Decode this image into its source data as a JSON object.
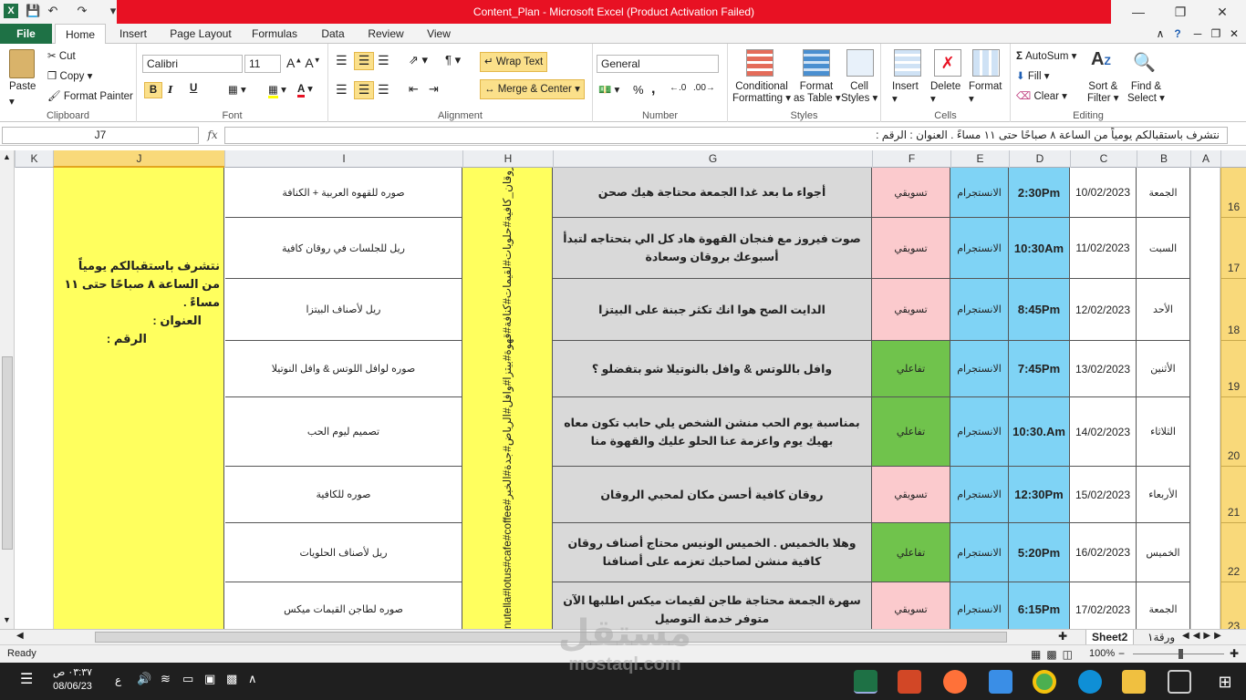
{
  "window": {
    "title": "Content_Plan  -  Microsoft Excel (Product Activation Failed)"
  },
  "tabs": [
    "File",
    "Home",
    "Insert",
    "Page Layout",
    "Formulas",
    "Data",
    "Review",
    "View"
  ],
  "ribbon": {
    "clipboard": {
      "paste": "Paste",
      "cut": "Cut",
      "copy": "Copy",
      "format_painter": "Format Painter",
      "label": "Clipboard"
    },
    "font": {
      "name": "Calibri",
      "size": "11",
      "bold": "B",
      "italic": "I",
      "underline": "U",
      "label": "Font"
    },
    "alignment": {
      "wrap_text": "Wrap Text",
      "merge_center": "Merge & Center",
      "label": "Alignment"
    },
    "number": {
      "format": "General",
      "percent": "%",
      "comma": ",",
      "label": "Number"
    },
    "styles": {
      "conditional_1": "Conditional",
      "conditional_2": "Formatting",
      "format_as_table_1": "Format",
      "format_as_table_2": "as Table",
      "cell_styles_1": "Cell",
      "cell_styles_2": "Styles",
      "label": "Styles"
    },
    "cells": {
      "insert": "Insert",
      "delete": "Delete",
      "format": "Format",
      "label": "Cells"
    },
    "editing": {
      "autosum": "AutoSum",
      "fill": "Fill",
      "clear": "Clear",
      "sort_1": "Sort &",
      "sort_2": "Filter",
      "find_1": "Find &",
      "find_2": "Select",
      "label": "Editing"
    }
  },
  "formula_bar": {
    "name_box": "J7",
    "fx": "fx",
    "content": "نتشرف باستقبالكم يومياً من الساعة ٨ صباحًا حتى ١١ مساءً .        العنوان :                         الرقم :"
  },
  "columns": [
    "K",
    "J",
    "I",
    "H",
    "G",
    "F",
    "E",
    "D",
    "C",
    "B",
    "A"
  ],
  "rows": [
    {
      "num": "16",
      "day": "الجمعة",
      "date": "10/02/2023",
      "time": "2:30Pm",
      "platform": "الانستجرام",
      "type": "تسويقي",
      "type_color": "pink",
      "text": "أجواء ما بعد غدا الجمعة محتاجة هيك صحن",
      "idea": "صوره للقهوه العربية + الكنافة"
    },
    {
      "num": "17",
      "day": "السبت",
      "date": "11/02/2023",
      "time": "10:30Am",
      "platform": "الانستجرام",
      "type": "تسويقي",
      "type_color": "pink",
      "text": "صوت فيروز مع فنجان القهوة هاد كل الي بتحتاجه لتبدأ أسبوعك بروقان وسعادة",
      "idea": "ريل للجلسات في روقان كافية"
    },
    {
      "num": "18",
      "day": "الأحد",
      "date": "12/02/2023",
      "time": "8:45Pm",
      "platform": "الانستجرام",
      "type": "تسويقي",
      "type_color": "pink",
      "text": "الدايت الصح هوا انك تكثر جبنة على البيتزا",
      "idea": "ريل لأصناف البيتزا"
    },
    {
      "num": "19",
      "day": "الأثنين",
      "date": "13/02/2023",
      "time": "7:45Pm",
      "platform": "الانستجرام",
      "type": "تفاعلي",
      "type_color": "green",
      "text": "وافل باللوتس & وافل بالنوتيلا شو بتفضلو ؟",
      "idea": "صوره لوافل اللوتس & وافل النوتيلا"
    },
    {
      "num": "20",
      "day": "الثلاثاء",
      "date": "14/02/2023",
      "time": "10:30.Am",
      "platform": "الانستجرام",
      "type": "تفاعلي",
      "type_color": "green",
      "text": "بمناسبة يوم الحب منشن الشخص يلي حابب تكون معاه بهيك يوم واعزمة عنا الحلو عليك والقهوة منا",
      "idea": "تصميم ليوم الحب"
    },
    {
      "num": "21",
      "day": "الأربعاء",
      "date": "15/02/2023",
      "time": "12:30Pm",
      "platform": "الانستجرام",
      "type": "تسويقي",
      "type_color": "pink",
      "text": "روقان كافية أحسن مكان لمحبي الروقان",
      "idea": "صوره للكافية"
    },
    {
      "num": "22",
      "day": "الخميس",
      "date": "16/02/2023",
      "time": "5:20Pm",
      "platform": "الانستجرام",
      "type": "تفاعلي",
      "type_color": "green",
      "text": "وهلا بالخميس . الخميس الونيس محتاج أصناف روقان كافية منشن لصاحبك تعزمه على أصنافنا",
      "idea": "ريل لأصناف الحلويات"
    },
    {
      "num": "23",
      "day": "الجمعة",
      "date": "17/02/2023",
      "time": "6:15Pm",
      "platform": "الانستجرام",
      "type": "تسويقي",
      "type_color": "pink",
      "text": "سهرة الجمعة محتاجة طاجن لقيمات ميكس اطلبها الآن متوفر خدمة التوصيل",
      "idea": "صوره لطاجن القيمات ميكس"
    }
  ],
  "column_j_text": "نتشرف باستقبالكم يومياً من الساعة ٨ صباحًا حتى ١١ مساءً .",
  "column_j_address": "العنوان :",
  "column_j_phone": "الرقم :",
  "column_h_text": "nutella#lotus#cafe#coffee#روقان_كافية#حلويات#لقيمات#كنافة#قهوة#بيتزا#وافل#الرياض#جدة#الخبر",
  "sheets": {
    "sheet2": "Sheet2",
    "sheet1": "ورقة١"
  },
  "status": {
    "ready": "Ready",
    "zoom": "100%"
  },
  "taskbar": {
    "time": "٠٣:٣٧ ص",
    "date": "08/06/23",
    "lang": "ع"
  },
  "watermark": {
    "word": "مستقل",
    "url": "mostaql.com"
  },
  "colors": {
    "excel_green": "#1e7145",
    "title_red": "#e81123",
    "time_blue": "#7fd3f5",
    "yellow": "#ffff5e",
    "pink": "#fbcacd",
    "green": "#70c34c"
  }
}
